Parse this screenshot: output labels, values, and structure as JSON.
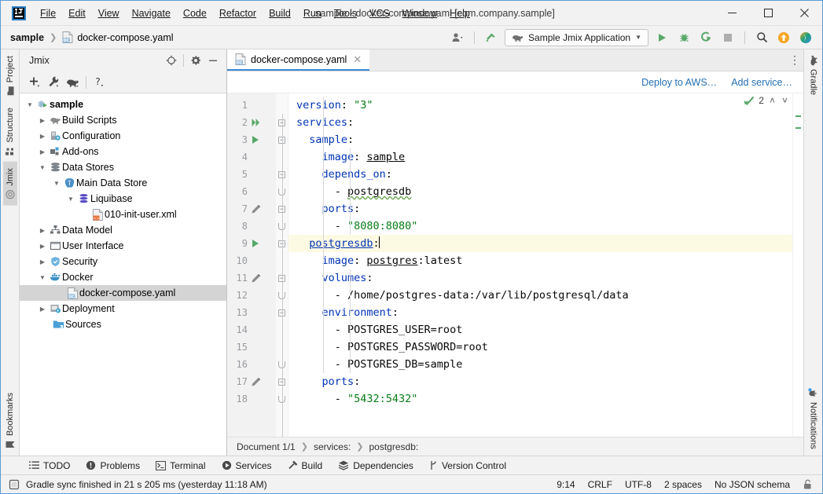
{
  "window": {
    "title": "sample - docker-compose.yaml [com.company.sample]",
    "logo_text": "IJ",
    "minimize": "—",
    "maximize": "☐",
    "close": "✕"
  },
  "menubar": {
    "items": [
      {
        "label": "File",
        "mnemonic": "F"
      },
      {
        "label": "Edit",
        "mnemonic": "E"
      },
      {
        "label": "View",
        "mnemonic": "V"
      },
      {
        "label": "Navigate",
        "mnemonic": "N"
      },
      {
        "label": "Code",
        "mnemonic": "C"
      },
      {
        "label": "Refactor",
        "mnemonic": "R"
      },
      {
        "label": "Build",
        "mnemonic": "B"
      },
      {
        "label": "Run",
        "mnemonic": "u"
      },
      {
        "label": "Tools",
        "mnemonic": "T"
      },
      {
        "label": "VCS",
        "mnemonic": ""
      },
      {
        "label": "Window",
        "mnemonic": "W"
      },
      {
        "label": "Help",
        "mnemonic": "H"
      }
    ]
  },
  "navbar": {
    "crumb_project": "sample",
    "crumb_file": "docker-compose.yaml",
    "run_config": "Sample Jmix Application",
    "icons": {
      "user": "user-avatar-icon",
      "updates": "update-arrow-icon",
      "run": "run-icon",
      "debug": "debug-icon",
      "run_coverage": "run-with-coverage-icon",
      "stop": "stop-icon",
      "search": "search-everywhere-icon",
      "notify": "update-project-icon",
      "ai": "ai-assistant-icon"
    }
  },
  "left_strip": {
    "tabs": [
      {
        "label": "Project",
        "icon": "project-folder-icon",
        "active": false
      },
      {
        "label": "Structure",
        "icon": "structure-icon",
        "active": false
      },
      {
        "label": "Jmix",
        "icon": "jmix-icon",
        "active": true
      }
    ],
    "bottom": [
      {
        "label": "Bookmarks",
        "icon": "bookmark-icon",
        "active": false
      }
    ]
  },
  "right_strip": {
    "tabs": [
      {
        "label": "Gradle",
        "icon": "gradle-elephant-icon",
        "active": false
      }
    ],
    "bottom": [
      {
        "label": "Notifications",
        "icon": "notifications-bell-icon",
        "active": false
      }
    ]
  },
  "project_panel": {
    "title": "Jmix",
    "header_icons": [
      "locate-target-icon",
      "gear-icon",
      "hide-minus-icon"
    ],
    "toolbar_icons": [
      "add-plus-icon",
      "wrench-icon",
      "gradle-elephant-icon",
      "help-question-icon"
    ],
    "tree": [
      {
        "label": "sample",
        "depth": 0,
        "arrow": "down",
        "icon": "module-icon",
        "bold": true,
        "selected": false
      },
      {
        "label": "Build Scripts",
        "depth": 1,
        "arrow": "right",
        "icon": "gradle-elephant-icon",
        "bold": false,
        "selected": false
      },
      {
        "label": "Configuration",
        "depth": 1,
        "arrow": "right",
        "icon": "configuration-icon",
        "bold": false,
        "selected": false
      },
      {
        "label": "Add-ons",
        "depth": 1,
        "arrow": "right",
        "icon": "addons-icon",
        "bold": false,
        "selected": false
      },
      {
        "label": "Data Stores",
        "depth": 1,
        "arrow": "down",
        "icon": "datastore-icon",
        "bold": false,
        "selected": false
      },
      {
        "label": "Main Data Store",
        "depth": 2,
        "arrow": "down",
        "icon": "postgres-icon",
        "bold": false,
        "selected": false
      },
      {
        "label": "Liquibase",
        "depth": 3,
        "arrow": "down",
        "icon": "liquibase-icon",
        "bold": false,
        "selected": false
      },
      {
        "label": "010-init-user.xml",
        "depth": 4,
        "arrow": "none",
        "icon": "xml-file-icon",
        "bold": false,
        "selected": false
      },
      {
        "label": "Data Model",
        "depth": 1,
        "arrow": "right",
        "icon": "datamodel-icon",
        "bold": false,
        "selected": false
      },
      {
        "label": "User Interface",
        "depth": 1,
        "arrow": "right",
        "icon": "ui-icon",
        "bold": false,
        "selected": false
      },
      {
        "label": "Security",
        "depth": 1,
        "arrow": "right",
        "icon": "shield-icon",
        "bold": false,
        "selected": false
      },
      {
        "label": "Docker",
        "depth": 1,
        "arrow": "down",
        "icon": "docker-icon",
        "bold": false,
        "selected": false
      },
      {
        "label": "docker-compose.yaml",
        "depth": 2,
        "arrow": "none",
        "icon": "docker-compose-icon",
        "bold": false,
        "selected": true
      },
      {
        "label": "Deployment",
        "depth": 1,
        "arrow": "right",
        "icon": "deployment-icon",
        "bold": false,
        "selected": false
      },
      {
        "label": "Sources",
        "depth": 1,
        "arrow": "none",
        "icon": "sources-folder-icon",
        "bold": false,
        "selected": false
      }
    ]
  },
  "editor": {
    "tab_label": "docker-compose.yaml",
    "tab_icon": "docker-compose-icon",
    "tab_close": "✕",
    "more_options": "⋮",
    "links": {
      "deploy": "Deploy to AWS…",
      "add_service": "Add service…"
    },
    "inspection": {
      "count": "2",
      "icon": "inspection-ok-icon",
      "up": "˄",
      "down": "˅"
    },
    "lines": [
      {
        "n": "1",
        "marker": "none",
        "fold": "none",
        "hl": false
      },
      {
        "n": "2",
        "marker": "run-double",
        "fold": "open",
        "hl": false
      },
      {
        "n": "3",
        "marker": "run",
        "fold": "open",
        "hl": false
      },
      {
        "n": "4",
        "marker": "none",
        "fold": "none",
        "hl": false
      },
      {
        "n": "5",
        "marker": "none",
        "fold": "open",
        "hl": false
      },
      {
        "n": "6",
        "marker": "none",
        "fold": "end",
        "hl": false
      },
      {
        "n": "7",
        "marker": "edit",
        "fold": "open",
        "hl": false
      },
      {
        "n": "8",
        "marker": "none",
        "fold": "end",
        "hl": false
      },
      {
        "n": "9",
        "marker": "run",
        "fold": "open",
        "hl": true
      },
      {
        "n": "10",
        "marker": "none",
        "fold": "none",
        "hl": false
      },
      {
        "n": "11",
        "marker": "edit",
        "fold": "open",
        "hl": false
      },
      {
        "n": "12",
        "marker": "none",
        "fold": "end",
        "hl": false
      },
      {
        "n": "13",
        "marker": "none",
        "fold": "open",
        "hl": false
      },
      {
        "n": "14",
        "marker": "none",
        "fold": "none",
        "hl": false
      },
      {
        "n": "15",
        "marker": "none",
        "fold": "none",
        "hl": false
      },
      {
        "n": "16",
        "marker": "none",
        "fold": "end",
        "hl": false
      },
      {
        "n": "17",
        "marker": "edit",
        "fold": "open",
        "hl": false
      },
      {
        "n": "18",
        "marker": "none",
        "fold": "end",
        "hl": false
      }
    ],
    "code_text": [
      "version: \"3\"",
      "services:",
      "  sample:",
      "    image: sample",
      "    depends_on:",
      "      - postgresdb",
      "    ports:",
      "      - \"8080:8080\"",
      "  postgresdb:",
      "    image: postgres:latest",
      "    volumes:",
      "      - /home/postgres-data:/var/lib/postgresql/data",
      "    environment:",
      "      - POSTGRES_USER=root",
      "      - POSTGRES_PASSWORD=root",
      "      - POSTGRES_DB=sample",
      "    ports:",
      "      - \"5432:5432\""
    ],
    "breadcrumb": {
      "document": "Document 1/1",
      "path": [
        "services:",
        "postgresdb:"
      ]
    }
  },
  "bottom_tools": [
    {
      "label": "TODO",
      "icon": "todo-list-icon"
    },
    {
      "label": "Problems",
      "icon": "problems-warning-icon"
    },
    {
      "label": "Terminal",
      "icon": "terminal-icon"
    },
    {
      "label": "Services",
      "icon": "services-play-icon"
    },
    {
      "label": "Build",
      "icon": "build-hammer-icon"
    },
    {
      "label": "Dependencies",
      "icon": "dependencies-stack-icon"
    },
    {
      "label": "Version Control",
      "icon": "vcs-branch-icon"
    }
  ],
  "statusbar": {
    "message": "Gradle sync finished in 21 s 205 ms (yesterday 11:18 AM)",
    "message_icon": "event-log-icon",
    "caret": "9:14",
    "line_sep": "CRLF",
    "encoding": "UTF-8",
    "indent": "2 spaces",
    "schema": "No JSON schema",
    "lock_icon": "unlocked-padlock-icon"
  },
  "colors": {
    "accent_blue": "#3d8ad4",
    "link_blue": "#2470b3",
    "keyword_blue": "#0033b3",
    "string_green": "#067d17",
    "run_green": "#59a869",
    "highlight_line": "#fdfae4",
    "panel_bg": "#f2f2f2",
    "selection_gray": "#d4d4d4"
  }
}
